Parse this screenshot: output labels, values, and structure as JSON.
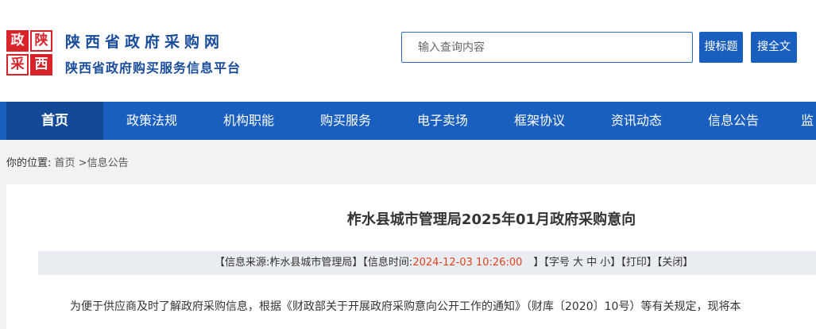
{
  "header": {
    "logo": {
      "tl": "政",
      "tr": "陕",
      "bl": "采",
      "br": "西"
    },
    "site_title": "陕西省政府采购网",
    "site_subtitle": "陕西省政府购买服务信息平台",
    "search_placeholder": "输入查询内容",
    "btn_search_title": "搜标题",
    "btn_search_full": "搜全文"
  },
  "nav": {
    "items": [
      {
        "label": "首页"
      },
      {
        "label": "政策法规"
      },
      {
        "label": "机构职能"
      },
      {
        "label": "购买服务"
      },
      {
        "label": "电子卖场"
      },
      {
        "label": "框架协议"
      },
      {
        "label": "资讯动态"
      },
      {
        "label": "信息公告"
      },
      {
        "label": "监"
      }
    ]
  },
  "breadcrumb": {
    "label": "你的位置:",
    "home": "首页",
    "sep": " >",
    "current": "信息公告"
  },
  "article": {
    "title": "柞水县城市管理局2025年01月政府采购意向",
    "meta": {
      "source_prefix": "【信息来源:",
      "source": "柞水县城市管理局",
      "source_suffix": "】",
      "time_prefix": "【信息时间:",
      "time": "2024-12-03 10:26:00",
      "time_suffix": "】",
      "font_size": "【字号 大 中 小】",
      "print": "【打印】",
      "close": "【关闭】"
    },
    "body_first_line": "为便于供应商及时了解政府采购信息，根据《财政部关于开展政府采购意向公开工作的通知》（财库〔2020〕10号）等有关规定，现将本"
  },
  "colors": {
    "brand_blue": "#1a5fbf",
    "nav_active": "#124a98",
    "logo_red": "#d8232a",
    "time_red": "#e4421f"
  }
}
